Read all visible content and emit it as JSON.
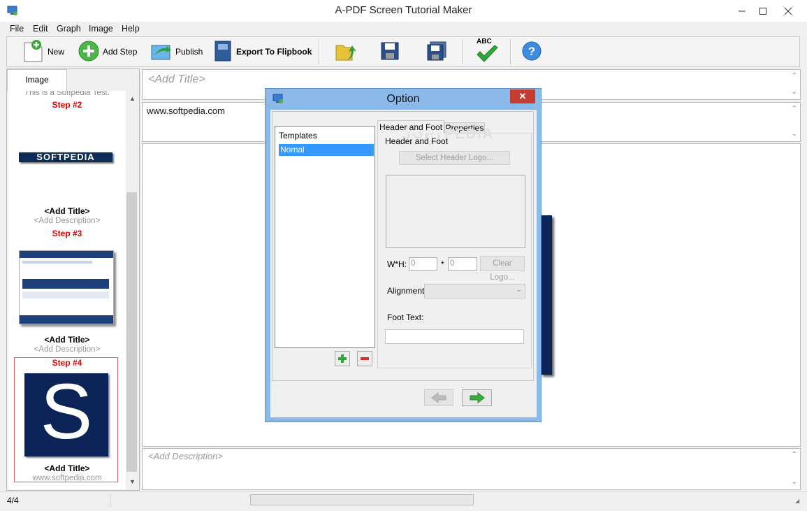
{
  "window": {
    "title": "A-PDF Screen Tutorial Maker"
  },
  "menu": [
    "File",
    "Edit",
    "Graph",
    "Image",
    "Help"
  ],
  "toolbar": {
    "new_label": "New",
    "add_step_label": "Add Step",
    "publish_label": "Publish",
    "export_label": "Export To Flipbook",
    "spell_text": "ABC"
  },
  "left_panel": {
    "tab_label": "Image",
    "partial_text": "This is a Softpedia Test.",
    "logo_text": "SOFTPEDIA",
    "thumb_s": "S",
    "steps": [
      {
        "name": "Step #2",
        "title": "<Add Title>",
        "desc": "<Add Description>"
      },
      {
        "name": "Step #3",
        "title": "<Add Title>",
        "desc": "<Add Description>"
      },
      {
        "name": "Step #4",
        "title": "<Add Title>",
        "desc": "www.softpedia.com"
      }
    ]
  },
  "editor": {
    "title_placeholder": "<Add Title>",
    "content_text": "www.softpedia.com",
    "desc_placeholder": "<Add Description>"
  },
  "dialog": {
    "title": "Option",
    "close": "✕",
    "templates_header": "Templates",
    "templates": [
      "Nomal"
    ],
    "tabs": [
      "Header and Foot",
      "Properties"
    ],
    "group_label": "Header and Foot",
    "select_logo_label": "Select Header Logo...",
    "wh_label": "W*H:",
    "width_value": "0",
    "times": "*",
    "height_value": "0",
    "clear_logo_label": "Clear Logo...",
    "alignment_label": "Alignment:",
    "foot_text_label": "Foot Text:",
    "watermark": "SOFTPEDIA"
  },
  "statusbar": {
    "page": "4/4"
  }
}
